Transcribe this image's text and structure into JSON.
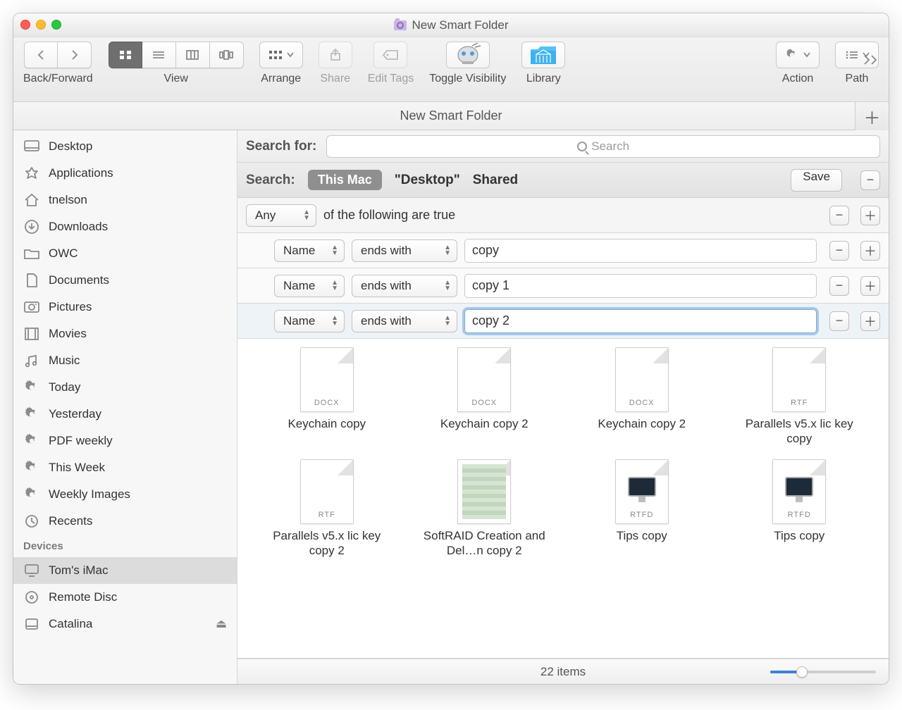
{
  "window": {
    "title": "New Smart Folder"
  },
  "toolbar": {
    "back_forward": "Back/Forward",
    "view": "View",
    "arrange": "Arrange",
    "share": "Share",
    "edit_tags": "Edit Tags",
    "toggle_visibility": "Toggle Visibility",
    "library": "Library",
    "action": "Action",
    "path": "Path"
  },
  "location": {
    "title": "New Smart Folder"
  },
  "sidebar": {
    "favorites": [
      {
        "label": "Desktop",
        "icon": "desktop"
      },
      {
        "label": "Applications",
        "icon": "apps"
      },
      {
        "label": "tnelson",
        "icon": "home"
      },
      {
        "label": "Downloads",
        "icon": "downloads"
      },
      {
        "label": "OWC",
        "icon": "folder"
      },
      {
        "label": "Documents",
        "icon": "documents"
      },
      {
        "label": "Pictures",
        "icon": "pictures"
      },
      {
        "label": "Movies",
        "icon": "movies"
      },
      {
        "label": "Music",
        "icon": "music"
      },
      {
        "label": "Today",
        "icon": "gear"
      },
      {
        "label": "Yesterday",
        "icon": "gear"
      },
      {
        "label": "PDF weekly",
        "icon": "gear"
      },
      {
        "label": "This Week",
        "icon": "gear"
      },
      {
        "label": "Weekly Images",
        "icon": "gear"
      },
      {
        "label": "Recents",
        "icon": "recents"
      }
    ],
    "devices_header": "Devices",
    "devices": [
      {
        "label": "Tom's iMac",
        "icon": "imac",
        "selected": true
      },
      {
        "label": "Remote Disc",
        "icon": "disc"
      },
      {
        "label": "Catalina",
        "icon": "disk",
        "eject": true
      }
    ]
  },
  "search": {
    "search_for_label": "Search for:",
    "placeholder": "Search",
    "scope_label": "Search:",
    "scope_thismac": "This Mac",
    "scope_desktop": "\"Desktop\"",
    "scope_shared": "Shared",
    "save": "Save"
  },
  "rules": {
    "group": {
      "operator": "Any",
      "suffix": "of the following are true"
    },
    "rows": [
      {
        "attr": "Name",
        "op": "ends with",
        "value": "copy"
      },
      {
        "attr": "Name",
        "op": "ends with",
        "value": "copy 1"
      },
      {
        "attr": "Name",
        "op": "ends with",
        "value": "copy 2",
        "focused": true
      }
    ]
  },
  "results": [
    {
      "name": "Keychain copy",
      "tag": "DOCX",
      "kind": "doc"
    },
    {
      "name": "Keychain copy 2",
      "tag": "DOCX",
      "kind": "doc"
    },
    {
      "name": "Keychain copy 2",
      "tag": "DOCX",
      "kind": "doc"
    },
    {
      "name": "Parallels v5.x lic key copy",
      "tag": "RTF",
      "kind": "doc"
    },
    {
      "name": "Parallels v5.x lic key copy 2",
      "tag": "RTF",
      "kind": "doc"
    },
    {
      "name": "SoftRAID Creation and Del…n copy 2",
      "tag": "",
      "kind": "pdf"
    },
    {
      "name": "Tips copy",
      "tag": "RTFD",
      "kind": "rtfd"
    },
    {
      "name": "Tips copy",
      "tag": "RTFD",
      "kind": "rtfd"
    }
  ],
  "status": {
    "text": "22 items"
  }
}
